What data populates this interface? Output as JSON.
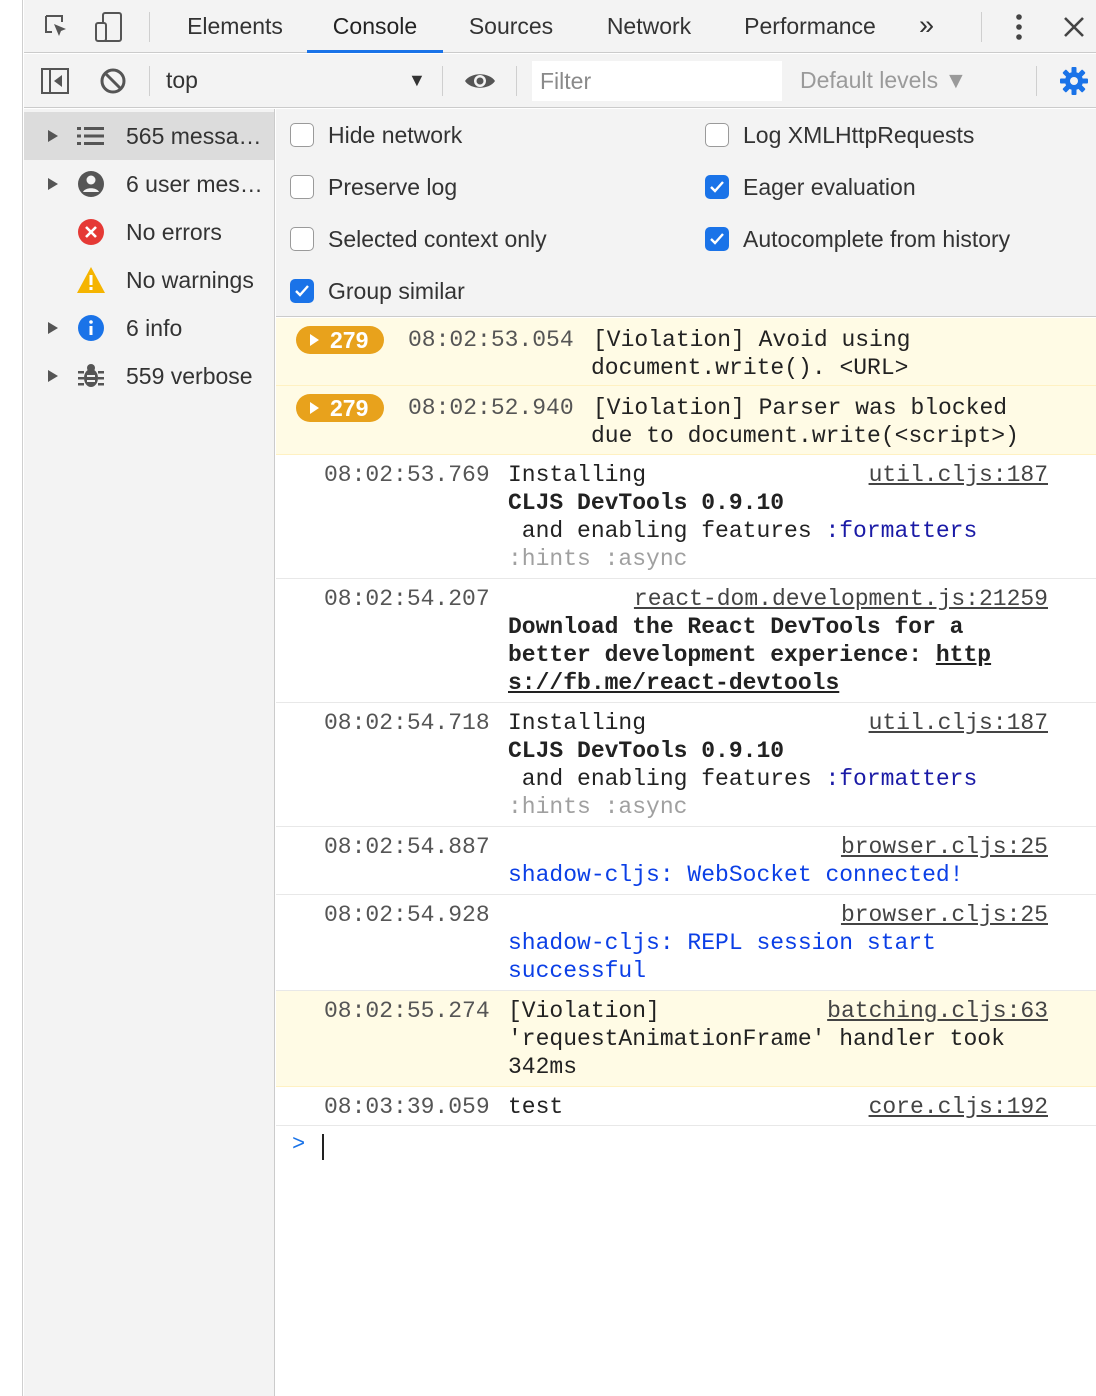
{
  "tabs": {
    "items": [
      "Elements",
      "Console",
      "Sources",
      "Network",
      "Performance"
    ],
    "active": "Console",
    "more_label": "»"
  },
  "toolbar": {
    "context": "top",
    "filter_placeholder": "Filter",
    "levels": "Default levels ▼"
  },
  "sidebar": {
    "items": [
      {
        "label": "565 messa…",
        "icon": "list-icon"
      },
      {
        "label": "6 user mes…",
        "icon": "user-icon"
      },
      {
        "label": "No errors",
        "icon": "error-icon"
      },
      {
        "label": "No warnings",
        "icon": "warning-icon"
      },
      {
        "label": "6 info",
        "icon": "info-icon"
      },
      {
        "label": "559 verbose",
        "icon": "bug-icon"
      }
    ]
  },
  "settings": {
    "hide_network": {
      "label": "Hide network",
      "checked": false
    },
    "preserve_log": {
      "label": "Preserve log",
      "checked": false
    },
    "selected_context": {
      "label": "Selected context only",
      "checked": false
    },
    "group_similar": {
      "label": "Group similar",
      "checked": true
    },
    "log_xhr": {
      "label": "Log XMLHttpRequests",
      "checked": false
    },
    "eager_eval": {
      "label": "Eager evaluation",
      "checked": true
    },
    "autocomplete": {
      "label": "Autocomplete from history",
      "checked": true
    }
  },
  "messages": {
    "m1": {
      "count": "279",
      "time": "08:02:53.054",
      "line1": "[Violation] Avoid using",
      "line2": "document.write(). <URL>"
    },
    "m2": {
      "count": "279",
      "time": "08:02:52.940",
      "line1": "[Violation] Parser was blocked",
      "line2": "due to document.write(<script>)"
    },
    "m3": {
      "time": "08:02:53.769",
      "line1": "Installing",
      "source": "util.cljs:187",
      "line2": "CLJS DevTools 0.9.10",
      "line3a": " and enabling features ",
      "line3b": ":formatters",
      "line4": ":hints :async"
    },
    "m4": {
      "time": "08:02:54.207",
      "source": "react-dom.development.js:21259",
      "line1": "Download the React DevTools for a",
      "line2a": "better development experience: ",
      "line2b": "http",
      "line3": "s://fb.me/react-devtools"
    },
    "m5": {
      "time": "08:02:54.718",
      "line1": "Installing",
      "source": "util.cljs:187",
      "line2": "CLJS DevTools 0.9.10",
      "line3a": " and enabling features ",
      "line3b": ":formatters",
      "line4": ":hints :async"
    },
    "m6": {
      "time": "08:02:54.887",
      "source": "browser.cljs:25",
      "line1": "shadow-cljs: WebSocket connected!"
    },
    "m7": {
      "time": "08:02:54.928",
      "source": "browser.cljs:25",
      "line1": "shadow-cljs: REPL session start",
      "line2": "successful"
    },
    "m8": {
      "time": "08:02:55.274",
      "line1": "[Violation]",
      "source": "batching.cljs:63",
      "line2": "'requestAnimationFrame' handler took",
      "line3": "342ms"
    },
    "m9": {
      "time": "08:03:39.059",
      "line1": "test",
      "source": "core.cljs:192"
    }
  },
  "prompt": {
    "symbol": ">"
  }
}
